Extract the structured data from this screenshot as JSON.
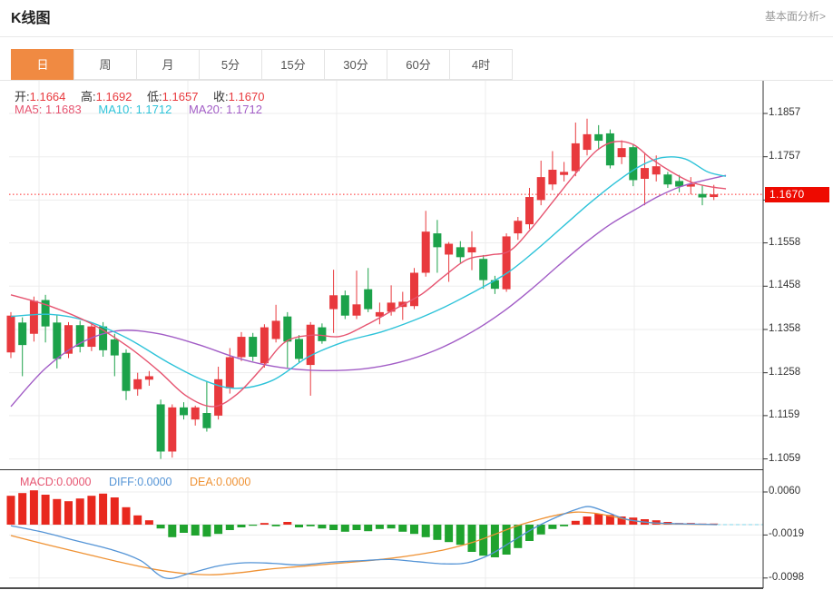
{
  "header": {
    "title": "K线图",
    "link": "基本面分析>"
  },
  "tabs": {
    "items": [
      "日",
      "周",
      "月",
      "5分",
      "15分",
      "30分",
      "60分",
      "4时"
    ],
    "selected_index": 0
  },
  "ohlc": {
    "open_label": "开:",
    "open": "1.1664",
    "high_label": "高:",
    "high": "1.1692",
    "low_label": "低:",
    "low": "1.1657",
    "close_label": "收:",
    "close": "1.1670"
  },
  "ma": {
    "ma5_label": "MA5:",
    "ma5": "1.1683",
    "ma10_label": "MA10:",
    "ma10": "1.1712",
    "ma20_label": "MA20:",
    "ma20": "1.1712"
  },
  "macd_header": {
    "macd_label": "MACD:",
    "macd": "0.0000",
    "diff_label": "DIFF:",
    "diff": "0.0000",
    "dea_label": "DEA:",
    "dea": "0.0000"
  },
  "price_marker": {
    "value": "1.1670"
  },
  "colors": {
    "up": "#e8393d",
    "down": "#1ca24a",
    "ma5": "#e65470",
    "ma10": "#2ec3d9",
    "ma20": "#a25dc6",
    "diff": "#5494d6",
    "dea": "#ef9234",
    "marker": "#ee0a00",
    "dotted_price_line": "#ff2a2a",
    "macd_zero_dash": "#7fd4e8",
    "tab_selected": "#f08a42",
    "grid": "#ededed",
    "axis": "#333333"
  },
  "chart_data": {
    "type": "candlestick+macd",
    "title": "K线图",
    "y_axis_ticks": [
      "1.1857",
      "1.1757",
      "1.1657",
      "1.1558",
      "1.1458",
      "1.1358",
      "1.1258",
      "1.1159",
      "1.1059"
    ],
    "ylim": [
      1.104,
      1.19
    ],
    "current_price": 1.167,
    "grid": true,
    "candles_ohlc": [
      [
        1.1305,
        1.1398,
        1.1292,
        1.139
      ],
      [
        1.1374,
        1.1386,
        1.125,
        1.1322
      ],
      [
        1.1348,
        1.1434,
        1.133,
        1.1424
      ],
      [
        1.1426,
        1.1438,
        1.1328,
        1.1365
      ],
      [
        1.1374,
        1.1392,
        1.1268,
        1.129
      ],
      [
        1.1302,
        1.1375,
        1.1292,
        1.1368
      ],
      [
        1.1368,
        1.1378,
        1.1305,
        1.1318
      ],
      [
        1.1318,
        1.1372,
        1.1308,
        1.1365
      ],
      [
        1.1365,
        1.1375,
        1.1295,
        1.131
      ],
      [
        1.1335,
        1.1348,
        1.125,
        1.1298
      ],
      [
        1.1304,
        1.1312,
        1.1195,
        1.1216
      ],
      [
        1.122,
        1.1258,
        1.1205,
        1.1243
      ],
      [
        1.1242,
        1.1262,
        1.1228,
        1.125
      ],
      [
        1.1185,
        1.1196,
        1.1059,
        1.1076
      ],
      [
        1.1076,
        1.1185,
        1.1062,
        1.1178
      ],
      [
        1.1178,
        1.119,
        1.115,
        1.116
      ],
      [
        1.115,
        1.1182,
        1.1136,
        1.1178
      ],
      [
        1.1165,
        1.1238,
        1.1122,
        1.113
      ],
      [
        1.1159,
        1.1272,
        1.115,
        1.1243
      ],
      [
        1.1222,
        1.1315,
        1.121,
        1.1294
      ],
      [
        1.1294,
        1.1352,
        1.1285,
        1.1341
      ],
      [
        1.1341,
        1.135,
        1.1285,
        1.1295
      ],
      [
        1.128,
        1.137,
        1.127,
        1.1363
      ],
      [
        1.1336,
        1.1415,
        1.1328,
        1.1378
      ],
      [
        1.1388,
        1.1398,
        1.127,
        1.133
      ],
      [
        1.1336,
        1.1345,
        1.1282,
        1.129
      ],
      [
        1.1276,
        1.1375,
        1.1205,
        1.1369
      ],
      [
        1.1363,
        1.1372,
        1.1325,
        1.1331
      ],
      [
        1.1405,
        1.1496,
        1.135,
        1.1437
      ],
      [
        1.1437,
        1.1448,
        1.1382,
        1.139
      ],
      [
        1.139,
        1.1494,
        1.1382,
        1.1416
      ],
      [
        1.1451,
        1.15,
        1.1398,
        1.1405
      ],
      [
        1.1388,
        1.142,
        1.137,
        1.1398
      ],
      [
        1.1399,
        1.146,
        1.139,
        1.142
      ],
      [
        1.141,
        1.1445,
        1.138,
        1.1422
      ],
      [
        1.1412,
        1.15,
        1.1405,
        1.1489
      ],
      [
        1.1489,
        1.1632,
        1.148,
        1.1584
      ],
      [
        1.158,
        1.1611,
        1.1489,
        1.1548
      ],
      [
        1.1531,
        1.156,
        1.1468,
        1.1556
      ],
      [
        1.1548,
        1.1562,
        1.1512,
        1.1525
      ],
      [
        1.1536,
        1.1585,
        1.1495,
        1.1548
      ],
      [
        1.1521,
        1.153,
        1.1452,
        1.1472
      ],
      [
        1.1472,
        1.1482,
        1.144,
        1.1452
      ],
      [
        1.1451,
        1.158,
        1.1445,
        1.1573
      ],
      [
        1.158,
        1.1618,
        1.1565,
        1.1609
      ],
      [
        1.1601,
        1.1685,
        1.159,
        1.1664
      ],
      [
        1.1657,
        1.1748,
        1.1645,
        1.171
      ],
      [
        1.1693,
        1.177,
        1.168,
        1.1727
      ],
      [
        1.1715,
        1.1745,
        1.17,
        1.1722
      ],
      [
        1.1724,
        1.1836,
        1.1712,
        1.1788
      ],
      [
        1.1773,
        1.1845,
        1.176,
        1.1809
      ],
      [
        1.1809,
        1.183,
        1.1775,
        1.1794
      ],
      [
        1.1811,
        1.182,
        1.173,
        1.1737
      ],
      [
        1.1756,
        1.1795,
        1.174,
        1.1777
      ],
      [
        1.1779,
        1.1785,
        1.1689,
        1.1703
      ],
      [
        1.1706,
        1.1767,
        1.1645,
        1.1731
      ],
      [
        1.1716,
        1.176,
        1.17,
        1.1735
      ],
      [
        1.1716,
        1.1722,
        1.1685,
        1.1693
      ],
      [
        1.1701,
        1.1715,
        1.1675,
        1.1688
      ],
      [
        1.1688,
        1.171,
        1.167,
        1.1694
      ],
      [
        1.1671,
        1.169,
        1.1645,
        1.1663
      ],
      [
        1.1664,
        1.1692,
        1.1657,
        1.167
      ]
    ],
    "ma5_points": [
      [
        12,
        1.1438
      ],
      [
        55,
        1.1412
      ],
      [
        100,
        1.1372
      ],
      [
        140,
        1.132
      ],
      [
        175,
        1.1262
      ],
      [
        205,
        1.1205
      ],
      [
        235,
        1.118
      ],
      [
        262,
        1.121
      ],
      [
        290,
        1.1272
      ],
      [
        315,
        1.133
      ],
      [
        345,
        1.1345
      ],
      [
        375,
        1.1342
      ],
      [
        405,
        1.137
      ],
      [
        435,
        1.1405
      ],
      [
        465,
        1.144
      ],
      [
        490,
        1.1482
      ],
      [
        515,
        1.152
      ],
      [
        540,
        1.153
      ],
      [
        562,
        1.154
      ],
      [
        585,
        1.159
      ],
      [
        610,
        1.1655
      ],
      [
        635,
        1.172
      ],
      [
        658,
        1.1772
      ],
      [
        678,
        1.1792
      ],
      [
        698,
        1.1785
      ],
      [
        718,
        1.1752
      ],
      [
        740,
        1.1722
      ],
      [
        762,
        1.1698
      ],
      [
        782,
        1.1688
      ],
      [
        800,
        1.1683
      ]
    ],
    "ma10_points": [
      [
        12,
        1.1388
      ],
      [
        55,
        1.1393
      ],
      [
        95,
        1.1378
      ],
      [
        140,
        1.1338
      ],
      [
        185,
        1.1282
      ],
      [
        225,
        1.124
      ],
      [
        260,
        1.1222
      ],
      [
        300,
        1.124
      ],
      [
        340,
        1.1295
      ],
      [
        380,
        1.133
      ],
      [
        420,
        1.1352
      ],
      [
        455,
        1.1378
      ],
      [
        490,
        1.141
      ],
      [
        525,
        1.1448
      ],
      [
        560,
        1.149
      ],
      [
        590,
        1.154
      ],
      [
        620,
        1.1595
      ],
      [
        650,
        1.165
      ],
      [
        680,
        1.17
      ],
      [
        705,
        1.1735
      ],
      [
        730,
        1.1755
      ],
      [
        755,
        1.1752
      ],
      [
        780,
        1.1722
      ],
      [
        800,
        1.1712
      ]
    ],
    "ma20_points": [
      [
        12,
        1.118
      ],
      [
        50,
        1.1268
      ],
      [
        90,
        1.1328
      ],
      [
        130,
        1.1355
      ],
      [
        175,
        1.1348
      ],
      [
        220,
        1.1322
      ],
      [
        265,
        1.129
      ],
      [
        310,
        1.127
      ],
      [
        355,
        1.1263
      ],
      [
        400,
        1.1267
      ],
      [
        440,
        1.1282
      ],
      [
        480,
        1.131
      ],
      [
        520,
        1.1352
      ],
      [
        555,
        1.14
      ],
      [
        585,
        1.145
      ],
      [
        615,
        1.1505
      ],
      [
        645,
        1.1558
      ],
      [
        672,
        1.16
      ],
      [
        700,
        1.1635
      ],
      [
        725,
        1.1665
      ],
      [
        750,
        1.1688
      ],
      [
        775,
        1.1702
      ],
      [
        800,
        1.1714
      ]
    ],
    "macd": {
      "axis_ticks": [
        "0.0060",
        "-0.0019",
        "-0.0098"
      ],
      "ylim": [
        -0.011,
        0.007
      ],
      "histogram": [
        0.0053,
        0.0058,
        0.0063,
        0.0055,
        0.0047,
        0.0043,
        0.0048,
        0.0053,
        0.0057,
        0.005,
        0.0032,
        0.0017,
        0.0008,
        -0.0007,
        -0.0023,
        -0.0015,
        -0.002,
        -0.0022,
        -0.0017,
        -0.001,
        -0.0005,
        -0.0002,
        0.0003,
        -0.0003,
        0.0005,
        -0.0005,
        -0.0003,
        -0.0007,
        -0.001,
        -0.0013,
        -0.001,
        -0.0012,
        -0.0008,
        -0.0007,
        -0.0013,
        -0.0017,
        -0.0023,
        -0.0028,
        -0.0032,
        -0.0037,
        -0.005,
        -0.0057,
        -0.006,
        -0.0055,
        -0.0043,
        -0.003,
        -0.0018,
        -0.0008,
        -0.0003,
        0.0007,
        0.0015,
        0.002,
        0.0018,
        0.0015,
        0.0013,
        0.001,
        0.0008,
        0.0005,
        0.0003,
        0.0003,
        0.0002,
        0.0002
      ],
      "diff_points": [
        [
          12,
          -0.0002
        ],
        [
          45,
          -0.0013
        ],
        [
          85,
          -0.003
        ],
        [
          125,
          -0.0047
        ],
        [
          155,
          -0.0066
        ],
        [
          182,
          -0.0098
        ],
        [
          210,
          -0.0089
        ],
        [
          240,
          -0.0076
        ],
        [
          270,
          -0.007
        ],
        [
          300,
          -0.0071
        ],
        [
          330,
          -0.0074
        ],
        [
          365,
          -0.0069
        ],
        [
          400,
          -0.0066
        ],
        [
          430,
          -0.0064
        ],
        [
          460,
          -0.0068
        ],
        [
          490,
          -0.0072
        ],
        [
          515,
          -0.007
        ],
        [
          540,
          -0.0055
        ],
        [
          565,
          -0.003
        ],
        [
          590,
          -0.0005
        ],
        [
          615,
          0.0015
        ],
        [
          635,
          0.0028
        ],
        [
          650,
          0.0033
        ],
        [
          670,
          0.0022
        ],
        [
          690,
          0.001
        ],
        [
          715,
          0.0004
        ],
        [
          740,
          0.0002
        ],
        [
          765,
          0.0001
        ],
        [
          790,
          0.0
        ]
      ],
      "dea_points": [
        [
          12,
          -0.002
        ],
        [
          50,
          -0.0036
        ],
        [
          90,
          -0.0052
        ],
        [
          130,
          -0.0068
        ],
        [
          170,
          -0.0082
        ],
        [
          205,
          -0.009
        ],
        [
          235,
          -0.0092
        ],
        [
          265,
          -0.0088
        ],
        [
          295,
          -0.0082
        ],
        [
          330,
          -0.0077
        ],
        [
          365,
          -0.0072
        ],
        [
          400,
          -0.0067
        ],
        [
          430,
          -0.0062
        ],
        [
          460,
          -0.0055
        ],
        [
          490,
          -0.0046
        ],
        [
          520,
          -0.0033
        ],
        [
          545,
          -0.0018
        ],
        [
          570,
          -0.0002
        ],
        [
          595,
          0.001
        ],
        [
          615,
          0.0018
        ],
        [
          635,
          0.0023
        ],
        [
          655,
          0.0021
        ],
        [
          675,
          0.0015
        ],
        [
          695,
          0.0008
        ],
        [
          720,
          0.0003
        ],
        [
          750,
          0.0001
        ],
        [
          790,
          0.0
        ]
      ]
    }
  }
}
